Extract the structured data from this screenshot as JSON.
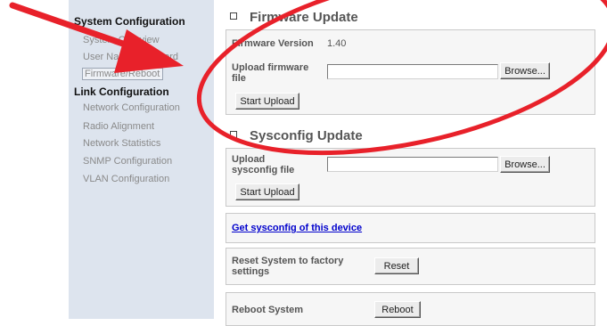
{
  "sidebar": {
    "system_heading": "System Configuration",
    "system_items": [
      "System Overview",
      "User Name/Password",
      "Firmware/Reboot"
    ],
    "link_heading": "Link Configuration",
    "link_items": [
      "Network Configuration",
      "Radio Alignment",
      "Network Statistics",
      "SNMP Configuration",
      "VLAN Configuration"
    ]
  },
  "firmware": {
    "title": "Firmware Update",
    "version_label": "Firmware Version",
    "version_value": "1.40",
    "upload_label": "Upload firmware file",
    "browse_label": "Browse...",
    "start_label": "Start Upload"
  },
  "sysconfig": {
    "title": "Sysconfig Update",
    "upload_label": "Upload sysconfig file",
    "browse_label": "Browse...",
    "start_label": "Start Upload"
  },
  "get_sysconfig_link": "Get sysconfig of this device",
  "reset": {
    "label": "Reset System to factory settings",
    "button": "Reset"
  },
  "reboot": {
    "label": "Reboot System",
    "button": "Reboot"
  },
  "annotation": {
    "color": "#e8212a"
  }
}
